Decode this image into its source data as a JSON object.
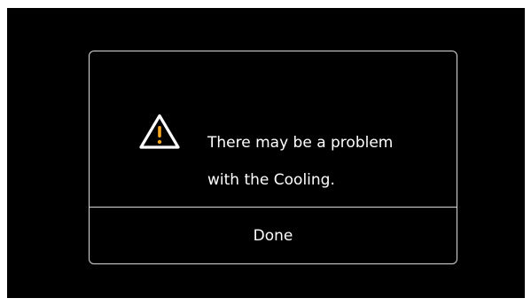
{
  "dialog": {
    "icon": "warning-triangle-icon",
    "message_line1": "There may be a problem",
    "message_line2": "with the Cooling.",
    "done_label": "Done"
  },
  "colors": {
    "background": "#000000",
    "border": "#d8d8d8",
    "text": "#ffffff",
    "warning_accent": "#f5a623"
  }
}
